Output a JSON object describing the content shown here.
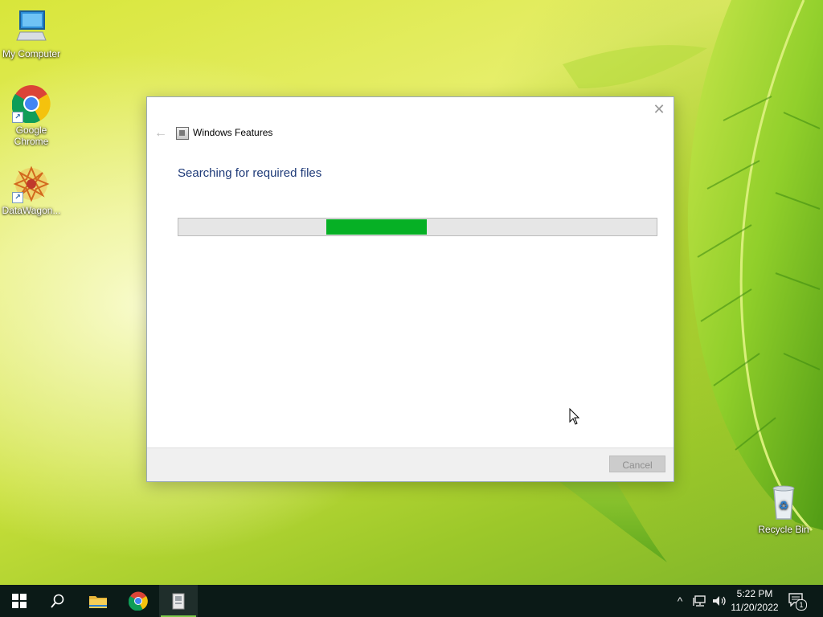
{
  "desktop": {
    "icons": [
      {
        "label": "My Computer"
      },
      {
        "label": "Google Chrome"
      },
      {
        "label": "DataWagon..."
      },
      {
        "label": "Recycle Bin"
      }
    ]
  },
  "dialog": {
    "title": "Windows Features",
    "heading": "Searching for required files",
    "close_glyph": "✕",
    "back_glyph": "←",
    "cancel_label": "Cancel",
    "progress": {
      "fill_start": 0.31,
      "fill_end": 0.52,
      "color": "#06b025"
    }
  },
  "taskbar": {
    "items": [
      "start-icon",
      "search-icon",
      "file-explorer-icon",
      "chrome-icon",
      "windows-features-icon"
    ],
    "tray": {
      "chevron_glyph": "^",
      "time": "5:22 PM",
      "date": "11/20/2022",
      "notification_count": "1"
    }
  }
}
